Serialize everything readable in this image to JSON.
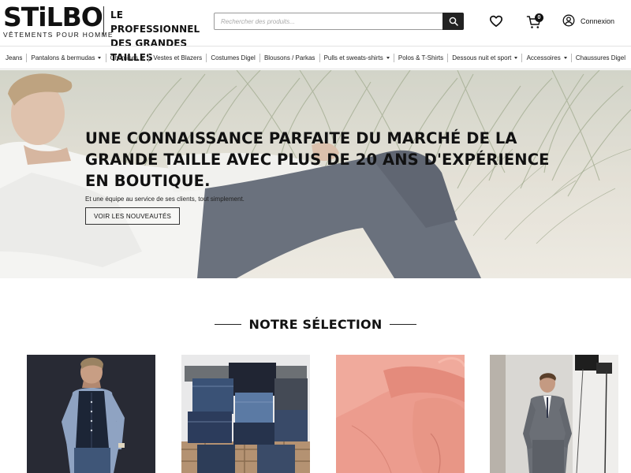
{
  "brand": {
    "logo_text": "STiLBO",
    "logo_sub": "VÊTEMENTS POUR HOMME",
    "tagline_line1": "LE PROFESSIONNEL",
    "tagline_line2": "DES GRANDES TAILLES"
  },
  "search": {
    "placeholder": "Rechercher des produits..."
  },
  "header": {
    "cart_count": "0",
    "login_label": "Connexion"
  },
  "nav": {
    "items": [
      {
        "label": "Jeans",
        "dropdown": false
      },
      {
        "label": "Pantalons & bermudas",
        "dropdown": true
      },
      {
        "label": "Chemises",
        "dropdown": true
      },
      {
        "label": "Vestes et Blazers",
        "dropdown": false
      },
      {
        "label": "Costumes Digel",
        "dropdown": false
      },
      {
        "label": "Blousons / Parkas",
        "dropdown": false
      },
      {
        "label": "Pulls et sweats-shirts",
        "dropdown": true
      },
      {
        "label": "Polos & T-Shirts",
        "dropdown": false
      },
      {
        "label": "Dessous nuit et sport",
        "dropdown": true
      },
      {
        "label": "Accessoires",
        "dropdown": true
      },
      {
        "label": "Chaussures Digel",
        "dropdown": false
      }
    ]
  },
  "hero": {
    "title": "UNE CONNAISSANCE PARFAITE DU MARCHÉ DE LA GRANDE TAILLE AVEC PLUS DE 20 ANS D'EXPÉRIENCE EN BOUTIQUE.",
    "subtitle": "Et une équipe au service de ses clients, tout simplement.",
    "cta_label": "VOIR LES NOUVEAUTÉS"
  },
  "selection": {
    "title": "NOTRE SÉLECTION",
    "cards": [
      {
        "name": "waistcoat-model"
      },
      {
        "name": "folded-sweaters"
      },
      {
        "name": "pink-shirt"
      },
      {
        "name": "grey-suit-model"
      }
    ]
  },
  "colors": {
    "text": "#111111",
    "accent_dark": "#222222",
    "border": "#e2e2e2"
  }
}
